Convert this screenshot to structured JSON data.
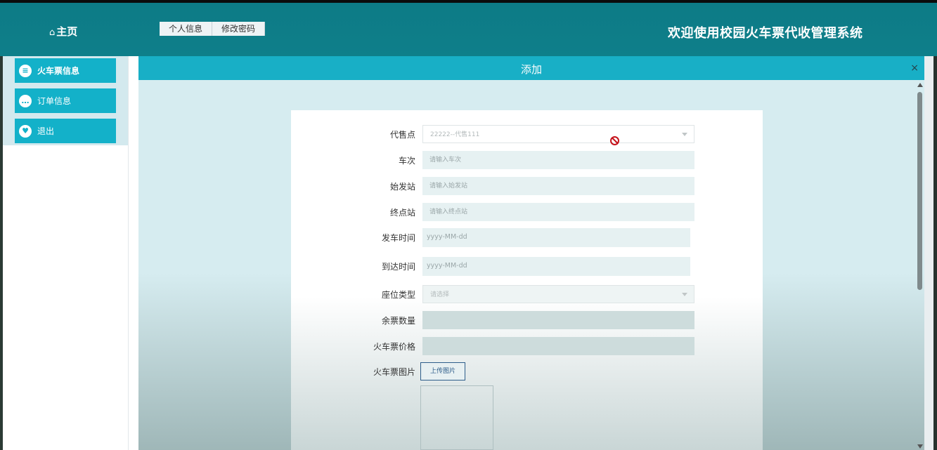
{
  "header": {
    "home_icon": "home-icon",
    "home_label": "主页",
    "tabs": [
      {
        "label": "个人信息"
      },
      {
        "label": "修改密码"
      }
    ],
    "system_title": "欢迎使用校园火车票代收管理系统",
    "brand_color": "#0e7f8a"
  },
  "sidebar": {
    "items": [
      {
        "label": "火车票信息",
        "icon": "list-icon",
        "active": true
      },
      {
        "label": "订单信息",
        "icon": "chat-icon",
        "active": false
      },
      {
        "label": "退出",
        "icon": "heart-icon",
        "active": false
      }
    ],
    "item_color": "#13b1c9"
  },
  "dialog": {
    "title": "添加",
    "close_label": "×",
    "form": {
      "agent_point": {
        "label": "代售点",
        "value": "22222--代售111"
      },
      "train_no": {
        "label": "车次",
        "placeholder": "请输入车次"
      },
      "origin": {
        "label": "始发站",
        "placeholder": "请输入始发站"
      },
      "destination": {
        "label": "终点站",
        "placeholder": "请输入终点站"
      },
      "depart_time": {
        "label": "发车时间",
        "placeholder": "yyyy-MM-dd"
      },
      "arrive_time": {
        "label": "到达时间",
        "placeholder": "yyyy-MM-dd"
      },
      "seat_type": {
        "label": "座位类型",
        "placeholder": "请选择"
      },
      "remaining": {
        "label": "余票数量",
        "value": ""
      },
      "price": {
        "label": "火车票价格",
        "value": ""
      },
      "image": {
        "label": "火车票图片",
        "upload_label": "上传图片"
      }
    }
  }
}
